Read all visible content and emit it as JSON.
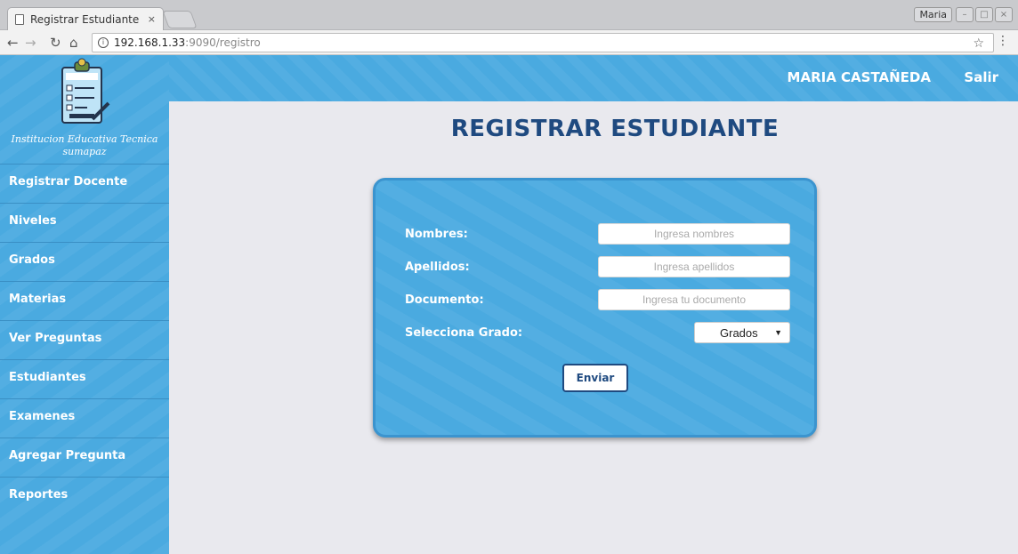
{
  "browser": {
    "tab_title": "Registrar Estudiante",
    "tab_close": "×",
    "window_user": "Maria",
    "url_host": "192.168.1.33",
    "url_path": ":9090/registro"
  },
  "header": {
    "user_name": "MARIA CASTAÑEDA",
    "logout_label": "Salir"
  },
  "sidebar": {
    "school_name_line1": "Institucion Educativa Tecnica",
    "school_name_line2": "sumapaz",
    "items": [
      {
        "label": "Registrar Docente"
      },
      {
        "label": "Niveles"
      },
      {
        "label": "Grados"
      },
      {
        "label": "Materias"
      },
      {
        "label": "Ver Preguntas"
      },
      {
        "label": "Estudiantes"
      },
      {
        "label": "Examenes"
      },
      {
        "label": "Agregar Pregunta"
      },
      {
        "label": "Reportes"
      }
    ]
  },
  "main": {
    "title": "REGISTRAR ESTUDIANTE",
    "form": {
      "nombres_label": "Nombres:",
      "nombres_placeholder": "Ingresa nombres",
      "apellidos_label": "Apellidos:",
      "apellidos_placeholder": "Ingresa apellidos",
      "documento_label": "Documento:",
      "documento_placeholder": "Ingresa tu documento",
      "grado_label": "Selecciona Grado:",
      "grado_selected": "Grados",
      "submit_label": "Enviar"
    }
  },
  "colors": {
    "accent": "#4aaae0",
    "title": "#1f4a80",
    "background": "#e9e9ee"
  }
}
